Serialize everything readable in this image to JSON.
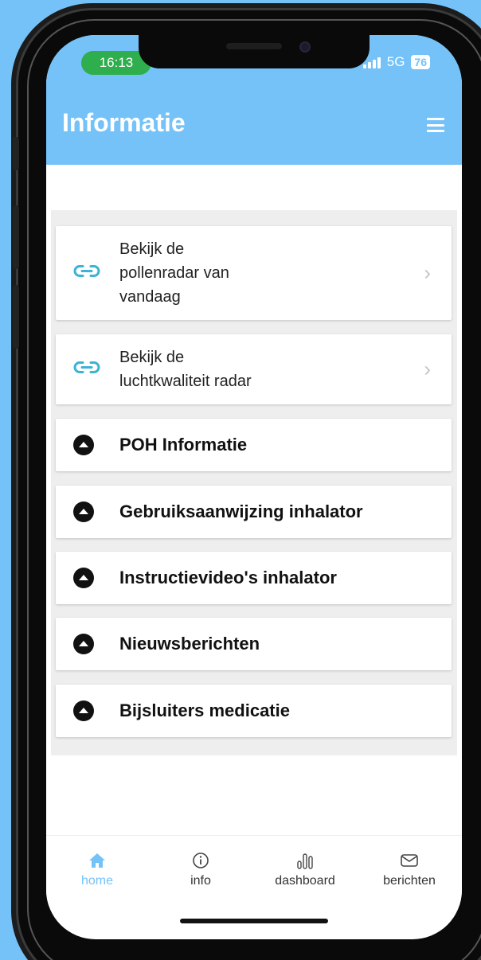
{
  "status_bar": {
    "time": "16:13",
    "network": "5G",
    "battery": "76"
  },
  "header": {
    "title": "Informatie"
  },
  "links": [
    {
      "label": "Bekijk de pollenradar van vandaag",
      "lines": [
        "Bekijk de",
        "pollenradar van",
        "vandaag"
      ]
    },
    {
      "label": "Bekijk de luchtkwaliteit radar",
      "lines": [
        "Bekijk de",
        "luchtkwaliteit radar"
      ]
    }
  ],
  "sections": [
    {
      "label": "POH Informatie"
    },
    {
      "label": "Gebruiksaanwijzing inhalator"
    },
    {
      "label": "Instructievideo's inhalator"
    },
    {
      "label": "Nieuwsberichten"
    },
    {
      "label": "Bijsluiters medicatie"
    }
  ],
  "tabs": [
    {
      "label": "home",
      "icon": "home-icon",
      "active": true
    },
    {
      "label": "info",
      "icon": "info-icon",
      "active": false
    },
    {
      "label": "dashboard",
      "icon": "bar-chart-icon",
      "active": false
    },
    {
      "label": "berichten",
      "icon": "mail-icon",
      "active": false
    }
  ],
  "colors": {
    "accent": "#74c2f8",
    "status_pill": "#2fae4e"
  }
}
